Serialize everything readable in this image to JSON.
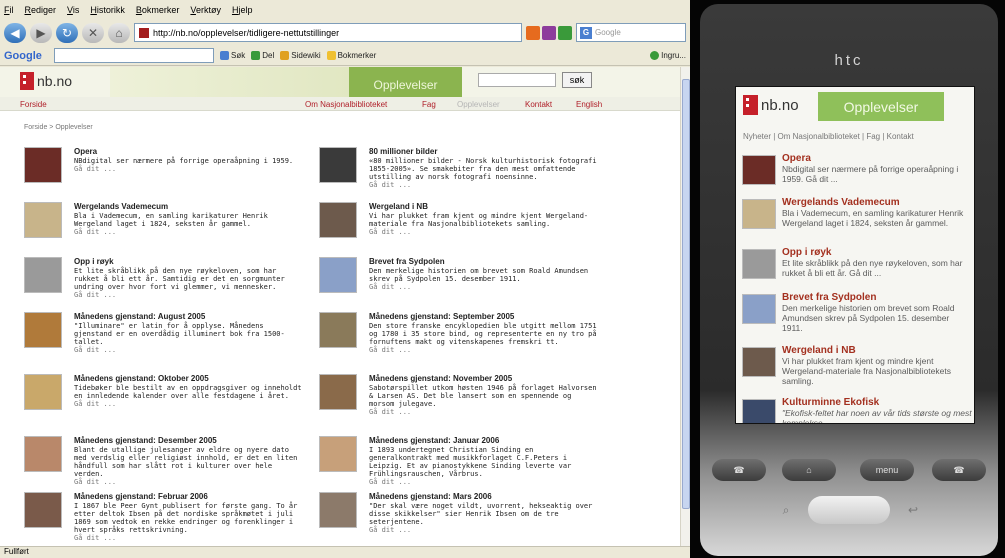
{
  "browser": {
    "menu": [
      "Fil",
      "Rediger",
      "Vis",
      "Historikk",
      "Bokmerker",
      "Verktøy",
      "Hjelp"
    ],
    "url": "http://nb.no/opplevelser/tidligere-nettutstillinger",
    "search_placeholder": "Google",
    "google_toolbar": {
      "logo": "Google",
      "items": [
        "Søk",
        "Del",
        "Sidewiki",
        "Bokmerker",
        "Ingru..."
      ]
    },
    "status": "Fullført"
  },
  "site": {
    "logo": "nb.no",
    "banner": "Opplevelser",
    "search_button": "søk",
    "nav": {
      "home": "Forside",
      "about": "Om Nasjonalbiblioteket",
      "fag": "Fag",
      "opplevelser": "Opplevelser",
      "kontakt": "Kontakt",
      "english": "English"
    },
    "breadcrumb": "Forside > Opplevelser",
    "items": [
      {
        "title": "Opera",
        "desc": "NBdigital ser nærmere på forrige operaåpning i 1959.",
        "more": "Gå dit ..."
      },
      {
        "title": "80 millioner bilder",
        "desc": "«80 millioner bilder - Norsk kulturhistorisk fotografi 1855-2005». Se smakebiter fra den mest omfattende utstilling av norsk fotografi noensinne.",
        "more": "Gå dit ..."
      },
      {
        "title": "Wergelands Vademecum",
        "desc": "Bla i Vademecum, en samling karikaturer Henrik Wergeland laget i 1824, seksten år gammel.",
        "more": "Gå dit ..."
      },
      {
        "title": "Wergeland i NB",
        "desc": "Vi har plukket fram kjent og mindre kjent Wergeland-materiale fra Nasjonalbibliotekets samling.",
        "more": "Gå dit ..."
      },
      {
        "title": "Opp i røyk",
        "desc": "Et lite skråblikk på den nye røykeloven, som har rukket å bli ett år. Samtidig er det en sorgmunter undring over hvor fort vi glemmer, vi mennesker.",
        "more": "Gå dit ..."
      },
      {
        "title": "Brevet fra Sydpolen",
        "desc": "Den merkelige historien om brevet som Roald Amundsen skrev på Sydpolen 15. desember 1911.",
        "more": "Gå dit ..."
      },
      {
        "title": "Månedens gjenstand: August 2005",
        "desc": "\"Illuminare\" er latin for å opplyse. Månedens gjenstand er en overdådig illuminert bok fra 1500-tallet.",
        "more": "Gå dit ..."
      },
      {
        "title": "Månedens gjenstand: September 2005",
        "desc": "Den store franske encyklopedien ble utgitt mellom 1751 og 1780 i 35 store bind, og representerte en ny tro på fornuftens makt og vitenskapenes fremskri tt.",
        "more": "Gå dit ..."
      },
      {
        "title": "Månedens gjenstand: Oktober 2005",
        "desc": "Tidebøker ble bestilt av en oppdragsgiver og inneholdt en innledende kalender over alle festdagene i året.",
        "more": "Gå dit ..."
      },
      {
        "title": "Månedens gjenstand: November 2005",
        "desc": "Sabotørspillet utkom høsten 1946 på forlaget Halvorsen & Larsen AS. Det ble lansert som en spennende og morsom julegave.",
        "more": "Gå dit ..."
      },
      {
        "title": "Månedens gjenstand: Desember 2005",
        "desc": "Blant de utallige julesanger av eldre og nyere dato med verdslig eller religiøst innhold, er det en liten håndfull som har slått rot i kulturer over hele verden.",
        "more": "Gå dit ..."
      },
      {
        "title": "Månedens gjenstand: Januar 2006",
        "desc": "I 1893 undertegnet Christian Sinding en generalkontrakt med musikkforlaget C.F.Peters i Leipzig. Et av pianostykkene Sinding leverte var Frühlingsrauschen, Vårbrus.",
        "more": "Gå dit ..."
      },
      {
        "title": "Månedens gjenstand: Februar 2006",
        "desc": "I 1867 ble Peer Gynt publisert for første gang. To år etter deltok Ibsen på det nordiske språkmøtet i juli 1869 som vedtok en rekke endringer og forenklinger i hvert språks rettskrivning.",
        "more": "Gå dit ..."
      },
      {
        "title": "Månedens gjenstand: Mars 2006",
        "desc": "\"Der skal være noget vildt, uvorrent, hekseaktig over disse skikkelser\" sier Henrik Ibsen om de tre seterjentene.",
        "more": "Gå dit ..."
      }
    ]
  },
  "phone": {
    "brand": "htc",
    "logo": "nb.no",
    "banner": "Opplevelser",
    "nav": "Nyheter | Om Nasjonalbiblioteket | Fag | Kontakt",
    "items": [
      {
        "title": "Opera",
        "desc": "Nbdigital ser nærmere på forrige operaåpning i 1959. Gå dit ..."
      },
      {
        "title": "Wergelands Vademecum",
        "desc": "Bla i Vademecum, en samling karikaturer Henrik Wergeland laget i 1824, seksten år gammel."
      },
      {
        "title": "Opp i røyk",
        "desc": "Et lite skråblikk på den nye røykeloven, som har rukket å bli ett år. Gå dit ..."
      },
      {
        "title": "Brevet fra Sydpolen",
        "desc": "Den merkelige historien om brevet som Roald Amundsen skrev på Sydpolen 15. desember 1911."
      },
      {
        "title": "Wergeland i NB",
        "desc": "Vi har plukket fram kjent og mindre kjent Wergeland-materiale fra Nasjonalbibliotekets samling."
      },
      {
        "title": "Kulturminne Ekofisk",
        "desc": "\"Ekofisk-feltet har noen av vår tids største og mest komplekse"
      }
    ],
    "keys": {
      "menu": "menu"
    }
  },
  "colors": {
    "nb_red": "#c5202a",
    "banner_green": "#8bb44f",
    "phone_title": "#a3301f"
  }
}
